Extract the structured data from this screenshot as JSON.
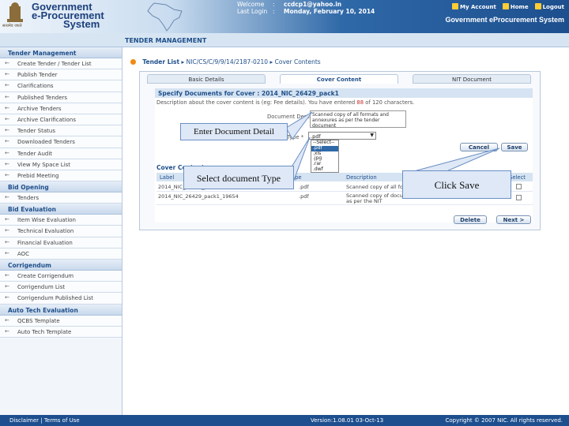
{
  "header": {
    "brand_line1": "Government",
    "brand_line2": "e-Procurement",
    "brand_line3": "System",
    "emblem_caption": "सत्यमेव जयते",
    "welcome_label": "Welcome",
    "welcome_value": "ccdcp1@yahoo.in",
    "last_login_label": "Last Login",
    "last_login_value": "Monday, February 10, 2014",
    "separator": ":",
    "my_account": "My Account",
    "home": "Home",
    "logout": "Logout",
    "system_name": "Government eProcurement System"
  },
  "subbar": {
    "title": "TENDER MANAGEMENT"
  },
  "sidebar": {
    "sections": [
      {
        "title": "Tender Management",
        "items": [
          "Create Tender / Tender List",
          "Publish Tender",
          "Clarifications",
          "Published Tenders",
          "Archive Tenders",
          "Archive Clarifications",
          "Tender Status",
          "Downloaded Tenders",
          "Tender Audit",
          "View My Space List",
          "Prebid Meeting"
        ]
      },
      {
        "title": "Bid Opening",
        "items": [
          "Tenders"
        ]
      },
      {
        "title": "Bid Evaluation",
        "items": [
          "Item Wise Evaluation",
          "Technical Evaluation",
          "Financial Evaluation",
          "AOC"
        ]
      },
      {
        "title": "Corrigendum",
        "items": [
          "Create Corrigendum",
          "Corrigendum List",
          "Corrigendum Published List"
        ]
      },
      {
        "title": "Auto Tech Evaluation",
        "items": [
          "QCBS Template",
          "Auto Tech Template"
        ]
      }
    ]
  },
  "breadcrumb": {
    "part1": "Tender List",
    "sep": "▸",
    "part2": "NIC/CS/C/9/9/14/2187-0210",
    "part3": "Cover Contents"
  },
  "tabs": [
    "Basic Details",
    "Cover Content",
    "NIT Document"
  ],
  "spec": {
    "heading": "Specify Documents for Cover : 2014_NIC_26429_pack1",
    "desc_prefix": "Description about the cover content is (eg: Fee details). You have entered ",
    "desc_count": "88",
    "desc_suffix": " of 120 characters.",
    "desc_label": "Document Description *",
    "desc_value": "Scanned copy of all formats and annexures as per the tender document",
    "dtype_label": "Type *",
    "dtype_value": ".pdf",
    "dtype_options": [
      "--Select--",
      ".pdf",
      ".xls",
      ".jpg",
      ".rar",
      ".dwf"
    ],
    "cancel": "Cancel",
    "save": "Save"
  },
  "cover_table": {
    "heading": "Cover Contents",
    "columns": [
      "Label",
      "Type",
      "Description",
      "Select"
    ],
    "rows": [
      {
        "label": "2014_NIC_26429_pack1",
        "type": ".pdf",
        "desc": "Scanned copy of all formats"
      },
      {
        "label": "2014_NIC_26429_pack1_19654",
        "type": ".pdf",
        "desc": "Scanned copy of documents to meet eligibility criteria as per the NIT"
      }
    ],
    "delete": "Delete",
    "next": "Next >"
  },
  "callouts": {
    "enter_detail": "Enter Document Detail",
    "select_type": "Select document Type",
    "click_save": "Click Save"
  },
  "footer": {
    "links": "Disclaimer  |  Terms of Use",
    "version": "Version:1.08.01 03-Oct-13",
    "copyright": "Copyright © 2007 NIC. All rights reserved."
  },
  "colors": {
    "brand_dark": "#1d4f8e",
    "accent_orange": "#f08a12",
    "callout_bg": "#dfe8f6"
  }
}
